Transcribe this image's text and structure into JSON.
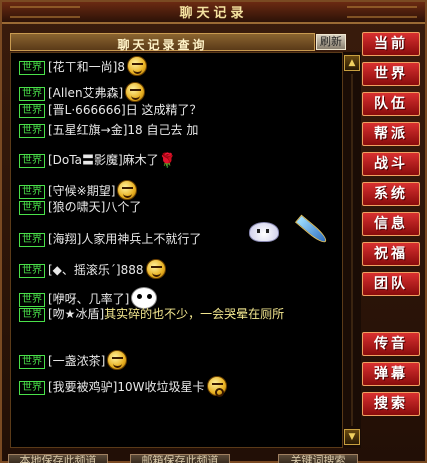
{
  "window": {
    "title": "聊天记录"
  },
  "header": {
    "title": "聊天记录查询",
    "refresh_label": "刷新"
  },
  "channel_label": "世界",
  "messages": [
    {
      "name": "[花ㄒ和一尚]",
      "text": "8",
      "emote": "smiley"
    },
    {
      "name": "[Allen艾弗森]",
      "text": "",
      "emote": "smiley"
    },
    {
      "name": "[晋L·666666]",
      "text": "日 这成精了？",
      "emote": ""
    },
    {
      "name": "[五星红旗→金]",
      "text": "18 自己去 加",
      "emote": ""
    },
    {
      "name": "[DoTa〓影魔]",
      "text": "麻木了",
      "emote": "rose"
    },
    {
      "name": "[守候※期望]",
      "text": "",
      "emote": "smiley"
    },
    {
      "name": "[狼の啸天]",
      "text": "八个了",
      "emote": ""
    },
    {
      "name": "[海翔]",
      "text": "人家用神兵上不就行了",
      "emote": "ghost"
    },
    {
      "name": "[◆、摇滚乐ˊ]",
      "text": "888",
      "emote": "smiley"
    },
    {
      "name": "[咿呀、几率了]",
      "text": "",
      "emote": "panda"
    },
    {
      "name": "[吻★冰盾]",
      "text": "其实碎的也不少，一会哭晕在厕所",
      "emote": ""
    },
    {
      "name": "[一盏浓茶]",
      "text": "",
      "emote": "smiley"
    },
    {
      "name": "[我要被鸡驴]",
      "text": "10W收垃圾星卡",
      "emote": "shock"
    }
  ],
  "sidebar": {
    "buttons": [
      "当前",
      "世界",
      "队伍",
      "帮派",
      "战斗",
      "系统",
      "信息",
      "祝福",
      "团队",
      "传音",
      "弹幕",
      "搜索"
    ]
  },
  "footer": {
    "left_button": "本地保存此频道",
    "middle_button": "邮箱保存此频道",
    "right_button": "关键词搜索"
  },
  "colors": {
    "channel": "#4ae04a",
    "highlight_text": "#f4e890",
    "side_button": "#c02020"
  }
}
